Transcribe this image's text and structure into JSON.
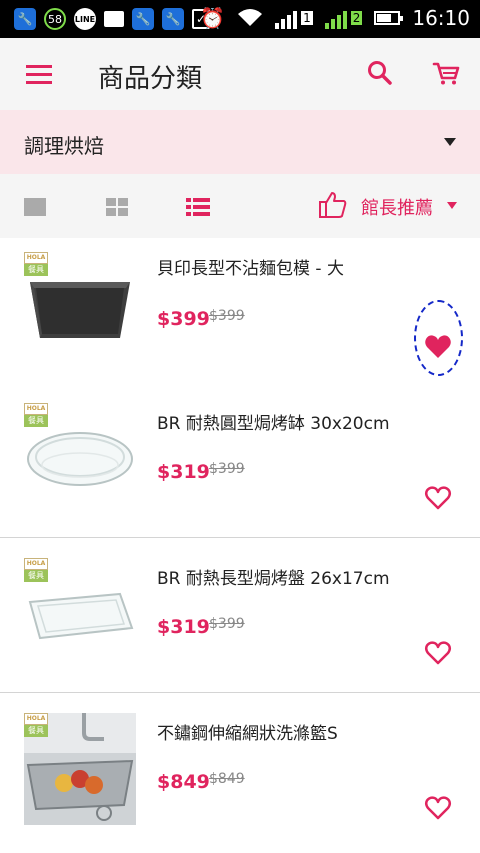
{
  "status_bar": {
    "notification_count": "58",
    "line_label": "LINE",
    "signal_badge_1": "1",
    "signal_badge_2": "2",
    "time": "16:10"
  },
  "header": {
    "title": "商品分類"
  },
  "category": {
    "selected": "調理烘焙"
  },
  "view_toolbar": {
    "sort_label": "館長推薦"
  },
  "badge": {
    "brand": "HOLA",
    "tag": "餐具"
  },
  "products": [
    {
      "name": "貝印長型不沾麵包模 - 大",
      "price": "$399",
      "original_price": "$399",
      "favorited": true,
      "image": "bread-pan"
    },
    {
      "name": "BR 耐熱圓型焗烤缽 30x20cm",
      "price": "$319",
      "original_price": "$399",
      "favorited": false,
      "image": "oval-glass-dish"
    },
    {
      "name": "BR 耐熱長型焗烤盤 26x17cm",
      "price": "$319",
      "original_price": "$399",
      "favorited": false,
      "image": "rect-glass-dish"
    },
    {
      "name": "不鏽鋼伸縮網狀洗滌籃S",
      "price": "$849",
      "original_price": "$849",
      "favorited": false,
      "image": "sink-basket"
    }
  ],
  "colors": {
    "accent": "#e0245e",
    "category_bg": "#fae6ea",
    "toolbar_bg": "#f5f5f5",
    "annotation": "#1428c8"
  }
}
